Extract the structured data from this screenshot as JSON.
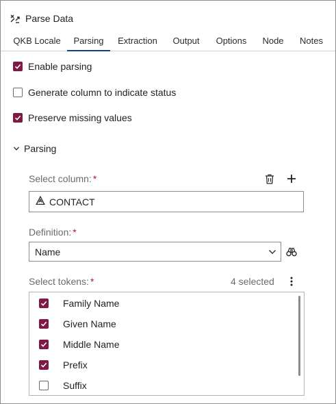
{
  "panel": {
    "title": "Parse Data",
    "title_icon": "parse-data-icon"
  },
  "tabs": [
    {
      "label": "QKB Locale",
      "active": false
    },
    {
      "label": "Parsing",
      "active": true
    },
    {
      "label": "Extraction",
      "active": false
    },
    {
      "label": "Output",
      "active": false
    },
    {
      "label": "Options",
      "active": false
    },
    {
      "label": "Node",
      "active": false
    },
    {
      "label": "Notes",
      "active": false
    }
  ],
  "options": {
    "enable_parsing": {
      "label": "Enable parsing",
      "checked": true
    },
    "generate_status": {
      "label": "Generate column to indicate status",
      "checked": false
    },
    "preserve_missing": {
      "label": "Preserve missing values",
      "checked": true
    }
  },
  "parsing_section": {
    "label": "Parsing",
    "expanded": true,
    "select_column": {
      "label": "Select column:",
      "required_mark": "*",
      "value": "CONTACT",
      "value_icon": "character-column-icon",
      "delete_icon": "trash-icon",
      "add_icon": "plus-icon"
    },
    "definition": {
      "label": "Definition:",
      "required_mark": "*",
      "value": "Name",
      "browse_icon": "binoculars-icon"
    },
    "tokens": {
      "label": "Select tokens:",
      "required_mark": "*",
      "selected_count": "4 selected",
      "menu_icon": "more-vertical-icon",
      "items": [
        {
          "label": "Family Name",
          "checked": true
        },
        {
          "label": "Given Name",
          "checked": true
        },
        {
          "label": "Middle Name",
          "checked": true
        },
        {
          "label": "Prefix",
          "checked": true
        },
        {
          "label": "Suffix",
          "checked": false
        }
      ]
    }
  },
  "colors": {
    "checkbox_checked": "#7f1a45",
    "active_tab_underline": "#0b3f8f",
    "required_asterisk": "#b3172f"
  }
}
